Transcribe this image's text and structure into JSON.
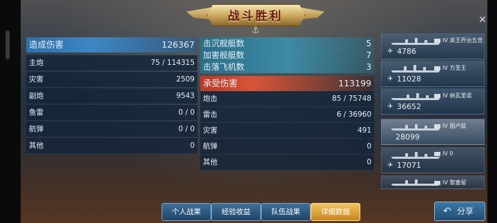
{
  "banner": {
    "title": "战斗胜利"
  },
  "left": {
    "header": {
      "label": "造成伤害",
      "value": "126367"
    },
    "rows": [
      {
        "label": "主炮",
        "value": "75 / 114315"
      },
      {
        "label": "灾害",
        "value": "2509"
      },
      {
        "label": "副炮",
        "value": "9543"
      },
      {
        "label": "鱼雷",
        "value": "0 / 0"
      },
      {
        "label": "航弹",
        "value": "0 / 0"
      },
      {
        "label": "其他",
        "value": "0"
      }
    ]
  },
  "middle": {
    "kills": [
      {
        "label": "击沉舰艇数",
        "value": "5"
      },
      {
        "label": "加害舰艇数",
        "value": "7"
      },
      {
        "label": "击落飞机数",
        "value": "3"
      }
    ],
    "taken_header": {
      "label": "承受伤害",
      "value": "113199"
    },
    "rows": [
      {
        "label": "炮击",
        "value": "85 / 75748"
      },
      {
        "label": "雷击",
        "value": "6 / 36960"
      },
      {
        "label": "灾害",
        "value": "491"
      },
      {
        "label": "航弹",
        "value": "0"
      },
      {
        "label": "其他",
        "value": "0"
      }
    ]
  },
  "ships": [
    {
      "tier": "IV",
      "name": "英王乔治五世",
      "damage": "4786",
      "plane": true
    },
    {
      "tier": "IV",
      "name": "万圣王",
      "damage": "11028",
      "plane": true
    },
    {
      "tier": "IV",
      "name": "纳瓦里诺",
      "damage": "36652",
      "plane": true
    },
    {
      "tier": "IV",
      "name": "图卢兹",
      "damage": "28099",
      "plane": false
    },
    {
      "tier": "IV",
      "name": "0",
      "damage": "17071",
      "plane": true
    },
    {
      "tier": "IV",
      "name": "黎塞留",
      "damage": "",
      "plane": false
    }
  ],
  "tabs": [
    {
      "label": "个人战果"
    },
    {
      "label": "经验收益"
    },
    {
      "label": "队伍战果"
    },
    {
      "label": "详细数据"
    }
  ],
  "share": {
    "label": "分享"
  },
  "icons": {
    "close": "close-icon",
    "share": "share-arrow-icon",
    "plane": "plane-icon",
    "anchor": "anchor-icon",
    "flag": "flag-icon"
  }
}
